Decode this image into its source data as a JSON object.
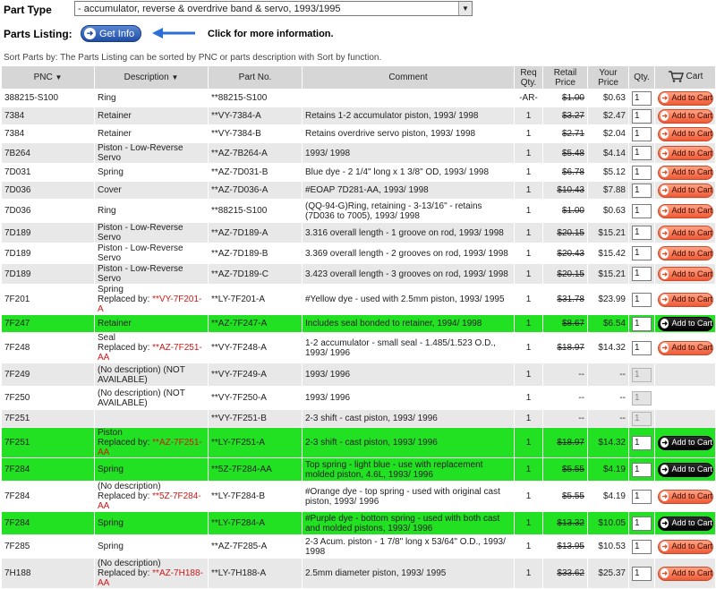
{
  "header": {
    "part_type_label": "Part Type",
    "part_type_value": "- accumulator, reverse & overdrive band & servo, 1993/1995",
    "parts_listing_label": "Parts Listing:",
    "get_info_label": "Get Info",
    "click_info_text": "Click for more information.",
    "sort_text": "Sort Parts by: The Parts Listing can be sorted by PNC or parts description with Sort by function."
  },
  "table": {
    "columns": {
      "pnc": "PNC",
      "description": "Description",
      "part_no": "Part No.",
      "comment": "Comment",
      "req_qty": "Req Qty.",
      "retail_price": "Retail Price",
      "your_price": "Your Price",
      "qty": "Qty.",
      "cart": "Cart"
    },
    "add_to_cart_label": "Add to Cart",
    "rows": [
      {
        "pnc": "388215-S100",
        "desc": "Ring",
        "replaced_label": "",
        "replaced_by": "",
        "part_no": "**88215-S100",
        "comment": "",
        "req": "-AR-",
        "retail": "$1.00",
        "yours": "$0.63",
        "qty": "1",
        "available": true,
        "highlight": false
      },
      {
        "pnc": "7384",
        "desc": "Retainer",
        "replaced_label": "",
        "replaced_by": "",
        "part_no": "**VY-7384-A",
        "comment": "Retains 1-2 accumulator piston, 1993/ 1998",
        "req": "1",
        "retail": "$3.27",
        "yours": "$2.47",
        "qty": "1",
        "available": true,
        "highlight": false
      },
      {
        "pnc": "7384",
        "desc": "Retainer",
        "replaced_label": "",
        "replaced_by": "",
        "part_no": "**VY-7384-B",
        "comment": "Retains overdrive servo piston, 1993/ 1998",
        "req": "1",
        "retail": "$2.71",
        "yours": "$2.04",
        "qty": "1",
        "available": true,
        "highlight": false
      },
      {
        "pnc": "7B264",
        "desc": "Piston - Low-Reverse Servo",
        "replaced_label": "",
        "replaced_by": "",
        "part_no": "**AZ-7B264-A",
        "comment": "1993/ 1998",
        "req": "1",
        "retail": "$5.48",
        "yours": "$4.14",
        "qty": "1",
        "available": true,
        "highlight": false
      },
      {
        "pnc": "7D031",
        "desc": "Spring",
        "replaced_label": "",
        "replaced_by": "",
        "part_no": "**AZ-7D031-B",
        "comment": "Blue dye - 2 1/4\" long x 1 3/8\" OD, 1993/ 1998",
        "req": "1",
        "retail": "$6.78",
        "yours": "$5.12",
        "qty": "1",
        "available": true,
        "highlight": false
      },
      {
        "pnc": "7D036",
        "desc": "Cover",
        "replaced_label": "",
        "replaced_by": "",
        "part_no": "**AZ-7D036-A",
        "comment": "#EOAP 7D281-AA, 1993/ 1998",
        "req": "1",
        "retail": "$10.43",
        "yours": "$7.88",
        "qty": "1",
        "available": true,
        "highlight": false
      },
      {
        "pnc": "7D036",
        "desc": "Ring",
        "replaced_label": "",
        "replaced_by": "",
        "part_no": "**88215-S100",
        "comment": "(QQ-94-G)Ring, retaining - 3-13/16\" - retains (7D036 to 7005), 1993/ 1998",
        "req": "1",
        "retail": "$1.00",
        "yours": "$0.63",
        "qty": "1",
        "available": true,
        "highlight": false
      },
      {
        "pnc": "7D189",
        "desc": "Piston - Low-Reverse Servo",
        "replaced_label": "",
        "replaced_by": "",
        "part_no": "**AZ-7D189-A",
        "comment": "3.316 overall length - 1 groove on rod, 1993/ 1998",
        "req": "1",
        "retail": "$20.15",
        "yours": "$15.21",
        "qty": "1",
        "available": true,
        "highlight": false
      },
      {
        "pnc": "7D189",
        "desc": "Piston - Low-Reverse Servo",
        "replaced_label": "",
        "replaced_by": "",
        "part_no": "**AZ-7D189-B",
        "comment": "3.369 overall length - 2 grooves on rod, 1993/ 1998",
        "req": "1",
        "retail": "$20.43",
        "yours": "$15.42",
        "qty": "1",
        "available": true,
        "highlight": false
      },
      {
        "pnc": "7D189",
        "desc": "Piston - Low-Reverse Servo",
        "replaced_label": "",
        "replaced_by": "",
        "part_no": "**AZ-7D189-C",
        "comment": "3.423 overall length - 3 grooves on rod, 1993/ 1998",
        "req": "1",
        "retail": "$20.15",
        "yours": "$15.21",
        "qty": "1",
        "available": true,
        "highlight": false
      },
      {
        "pnc": "7F201",
        "desc": "Spring",
        "replaced_label": "Replaced by: ",
        "replaced_by": "**VY-7F201-A",
        "part_no": "**LY-7F201-A",
        "comment": "#Yellow dye - used with 2.5mm piston, 1993/ 1995",
        "req": "1",
        "retail": "$31.78",
        "yours": "$23.99",
        "qty": "1",
        "available": true,
        "highlight": false
      },
      {
        "pnc": "7F247",
        "desc": "Retainer",
        "replaced_label": "",
        "replaced_by": "",
        "part_no": "**AZ-7F247-A",
        "comment": "Includes seal bonded to retainer, 1994/ 1998",
        "req": "1",
        "retail": "$8.67",
        "yours": "$6.54",
        "qty": "1",
        "available": true,
        "highlight": true
      },
      {
        "pnc": "7F248",
        "desc": "Seal",
        "replaced_label": "Replaced by: ",
        "replaced_by": "**AZ-7F251-AA",
        "part_no": "**VY-7F248-A",
        "comment": "1-2 accumulator - small seal - 1.485/1.523 O.D., 1993/ 1996",
        "req": "1",
        "retail": "$18.97",
        "yours": "$14.32",
        "qty": "1",
        "available": true,
        "highlight": false
      },
      {
        "pnc": "7F249",
        "desc": "(No description) (NOT AVAILABLE)",
        "replaced_label": "",
        "replaced_by": "",
        "part_no": "**VY-7F249-A",
        "comment": "1993/ 1996",
        "req": "1",
        "retail": "--",
        "yours": "--",
        "qty": "1",
        "available": false,
        "highlight": false
      },
      {
        "pnc": "7F250",
        "desc": "(No description) (NOT AVAILABLE)",
        "replaced_label": "",
        "replaced_by": "",
        "part_no": "**VY-7F250-A",
        "comment": "1993/ 1996",
        "req": "1",
        "retail": "--",
        "yours": "--",
        "qty": "1",
        "available": false,
        "highlight": false
      },
      {
        "pnc": "7F251",
        "desc": "",
        "replaced_label": "",
        "replaced_by": "",
        "part_no": "**VY-7F251-B",
        "comment": "2-3 shift - cast piston, 1993/ 1996",
        "req": "1",
        "retail": "--",
        "yours": "--",
        "qty": "1",
        "available": false,
        "highlight": false
      },
      {
        "pnc": "7F251",
        "desc": "Piston",
        "replaced_label": "Replaced by: ",
        "replaced_by": "**AZ-7F251-AA",
        "part_no": "**LY-7F251-A",
        "comment": "2-3 shift - cast piston, 1993/ 1996",
        "req": "1",
        "retail": "$18.97",
        "yours": "$14.32",
        "qty": "1",
        "available": true,
        "highlight": true
      },
      {
        "pnc": "7F284",
        "desc": "Spring",
        "replaced_label": "",
        "replaced_by": "",
        "part_no": "**5Z-7F284-AA",
        "comment": "Top spring - light blue - use with replacement molded piston, 4.6L, 1993/ 1996",
        "req": "1",
        "retail": "$5.55",
        "yours": "$4.19",
        "qty": "1",
        "available": true,
        "highlight": true
      },
      {
        "pnc": "7F284",
        "desc": "(No description)",
        "replaced_label": "Replaced by: ",
        "replaced_by": "**5Z-7F284-AA",
        "part_no": "**LY-7F284-B",
        "comment": "#Orange dye - top spring - used with original cast piston, 1993/ 1996",
        "req": "1",
        "retail": "$5.55",
        "yours": "$4.19",
        "qty": "1",
        "available": true,
        "highlight": false
      },
      {
        "pnc": "7F284",
        "desc": "Spring",
        "replaced_label": "",
        "replaced_by": "",
        "part_no": "**LY-7F284-A",
        "comment": "#Purple dye - bottom spring - used with both cast and molded pistons, 1993/ 1996",
        "req": "1",
        "retail": "$13.32",
        "yours": "$10.05",
        "qty": "1",
        "available": true,
        "highlight": true
      },
      {
        "pnc": "7F285",
        "desc": "Spring",
        "replaced_label": "",
        "replaced_by": "",
        "part_no": "**AZ-7F285-A",
        "comment": "2-3 Acum. piston - 1 7/8\" long x 53/64\" O.D., 1993/ 1998",
        "req": "1",
        "retail": "$13.95",
        "yours": "$10.53",
        "qty": "1",
        "available": true,
        "highlight": false
      },
      {
        "pnc": "7H188",
        "desc": "(No description)",
        "replaced_label": "Replaced by: ",
        "replaced_by": "**AZ-7H188-AA",
        "part_no": "**LY-7H188-A",
        "comment": "2.5mm diameter piston, 1993/ 1995",
        "req": "1",
        "retail": "$33.62",
        "yours": "$25.37",
        "qty": "1",
        "available": true,
        "highlight": false
      }
    ]
  },
  "colors": {
    "highlight_row": "#22e022",
    "add_to_cart": "#ef5a36",
    "replaced_link": "#d01818",
    "header_bg": "#d6d6d6"
  }
}
